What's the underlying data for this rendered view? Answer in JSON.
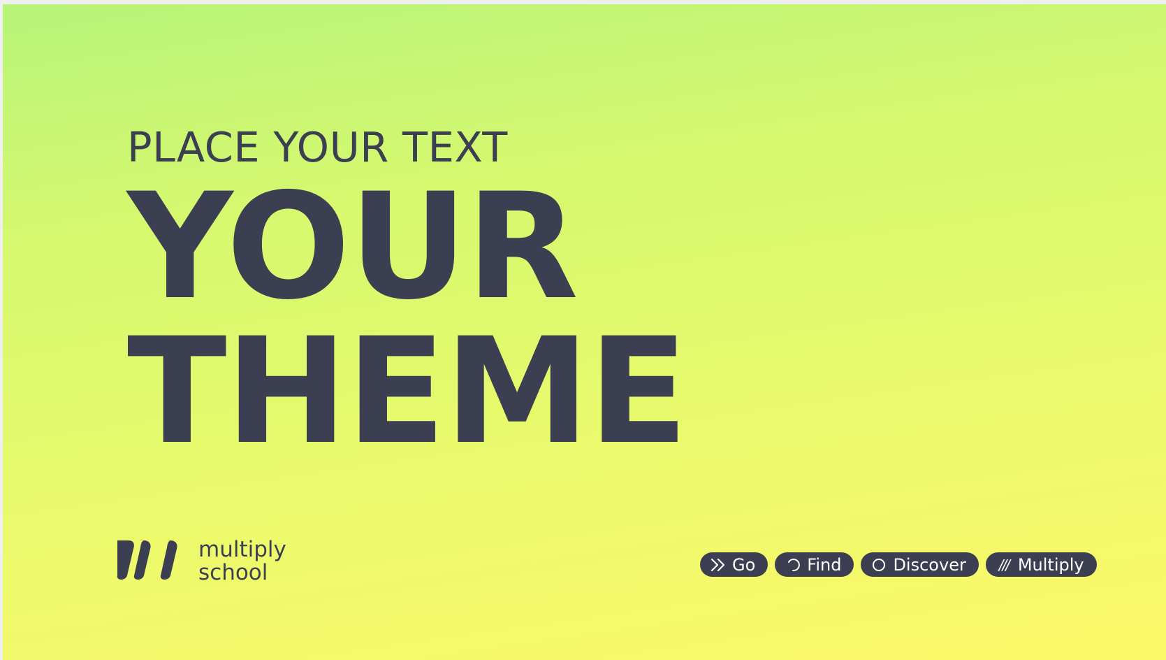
{
  "slide": {
    "kicker": "PLACE YOUR TEXT",
    "headline_line1": "YOUR",
    "headline_line2": "THEME"
  },
  "logo": {
    "line1": "multiply",
    "line2": "school",
    "icon": "three-slashes-logo"
  },
  "pills": [
    {
      "label": "Go",
      "icon": "double-chevron-right-icon"
    },
    {
      "label": "Find",
      "icon": "refresh-arc-icon"
    },
    {
      "label": "Discover",
      "icon": "circle-icon"
    },
    {
      "label": "Multiply",
      "icon": "triple-slash-icon",
      "glyph": "///"
    }
  ],
  "colors": {
    "text": "#3b3f51",
    "gradient_top": "#b7f478",
    "gradient_bottom": "#fdf868",
    "pill_bg": "#3b3f51",
    "pill_text": "#ffffff"
  }
}
